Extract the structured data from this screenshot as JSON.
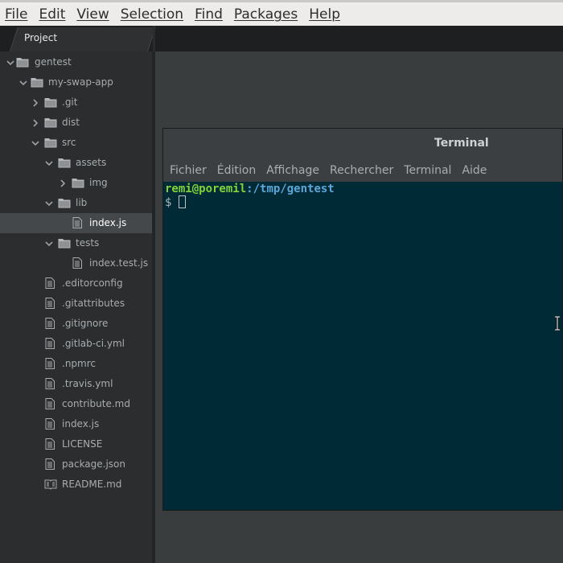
{
  "menubar": {
    "items": [
      "File",
      "Edit",
      "View",
      "Selection",
      "Find",
      "Packages",
      "Help"
    ]
  },
  "tabs": {
    "project_label": "Project"
  },
  "tree": [
    {
      "label": "gentest",
      "type": "folder",
      "chevron": "down",
      "depth": 0
    },
    {
      "label": "my-swap-app",
      "type": "folder",
      "chevron": "down",
      "depth": 1
    },
    {
      "label": ".git",
      "type": "folder",
      "chevron": "right",
      "depth": 2
    },
    {
      "label": "dist",
      "type": "folder",
      "chevron": "right",
      "depth": 2
    },
    {
      "label": "src",
      "type": "folder",
      "chevron": "down",
      "depth": 2
    },
    {
      "label": "assets",
      "type": "folder",
      "chevron": "down",
      "depth": 3
    },
    {
      "label": "img",
      "type": "folder",
      "chevron": "right",
      "depth": 4
    },
    {
      "label": "lib",
      "type": "folder",
      "chevron": "down",
      "depth": 3
    },
    {
      "label": "index.js",
      "type": "file",
      "chevron": "",
      "depth": 4,
      "selected": true
    },
    {
      "label": "tests",
      "type": "folder",
      "chevron": "down",
      "depth": 3
    },
    {
      "label": "index.test.js",
      "type": "file",
      "chevron": "",
      "depth": 4
    },
    {
      "label": ".editorconfig",
      "type": "file",
      "chevron": "",
      "depth": 2
    },
    {
      "label": ".gitattributes",
      "type": "file",
      "chevron": "",
      "depth": 2
    },
    {
      "label": ".gitignore",
      "type": "file",
      "chevron": "",
      "depth": 2
    },
    {
      "label": ".gitlab-ci.yml",
      "type": "file",
      "chevron": "",
      "depth": 2
    },
    {
      "label": ".npmrc",
      "type": "file",
      "chevron": "",
      "depth": 2
    },
    {
      "label": ".travis.yml",
      "type": "file",
      "chevron": "",
      "depth": 2
    },
    {
      "label": "contribute.md",
      "type": "file",
      "chevron": "",
      "depth": 2
    },
    {
      "label": "index.js",
      "type": "file",
      "chevron": "",
      "depth": 2
    },
    {
      "label": "LICENSE",
      "type": "file",
      "chevron": "",
      "depth": 2
    },
    {
      "label": "package.json",
      "type": "file",
      "chevron": "",
      "depth": 2
    },
    {
      "label": "README.md",
      "type": "readme",
      "chevron": "",
      "depth": 2
    }
  ],
  "terminal": {
    "title": "Terminal",
    "menu": [
      "Fichier",
      "Édition",
      "Affichage",
      "Rechercher",
      "Terminal",
      "Aide"
    ],
    "prompt_user": "remi@poremil",
    "prompt_sep": ":",
    "prompt_path": "/tmp/gentest",
    "prompt_symbol": "$ "
  },
  "colors": {
    "terminal_bg": "#002b36",
    "prompt_user": "#7fd43a",
    "prompt_path": "#5aa7d8",
    "sidebar_bg": "#2b2d2f",
    "selection_bg": "#45484b"
  }
}
